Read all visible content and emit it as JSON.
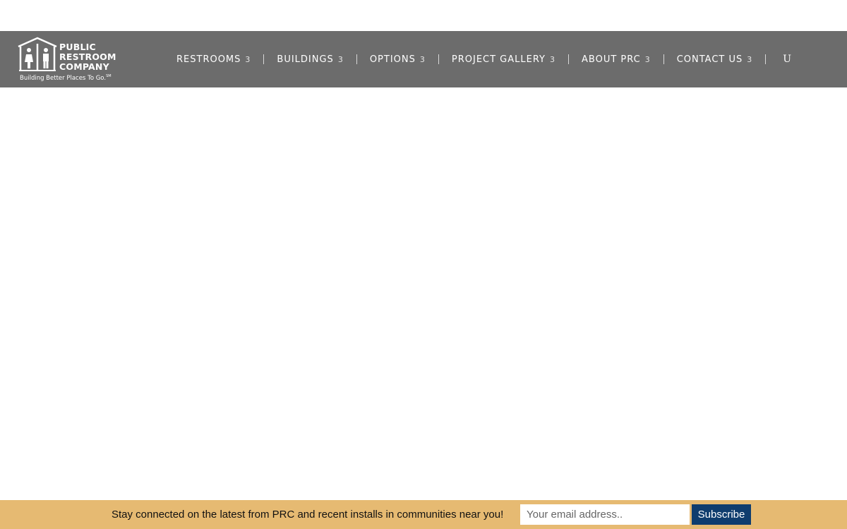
{
  "header": {
    "logo": {
      "lines": [
        "PUBLIC",
        "RESTROOM",
        "COMPANY"
      ],
      "tagline": "Building Better Places To Go.",
      "tagline_mark": "SM",
      "icon": "restroom-building-icon"
    },
    "nav": [
      {
        "label": "RESTROOMS",
        "caret": "3"
      },
      {
        "label": "BUILDINGS",
        "caret": "3"
      },
      {
        "label": "OPTIONS",
        "caret": "3"
      },
      {
        "label": "PROJECT GALLERY",
        "caret": "3"
      },
      {
        "label": "ABOUT PRC",
        "caret": "3"
      },
      {
        "label": "CONTACT US",
        "caret": "3"
      }
    ],
    "search_glyph": "U"
  },
  "footer_bar": {
    "message": "Stay connected on the latest from PRC and recent installs in communities near you!",
    "email_placeholder": "Your email address..",
    "subscribe_label": "Subscribe"
  },
  "colors": {
    "header_bg": "#6c6c6c",
    "footer_bg": "#e6ba72",
    "button_bg": "#0f3d6e"
  }
}
